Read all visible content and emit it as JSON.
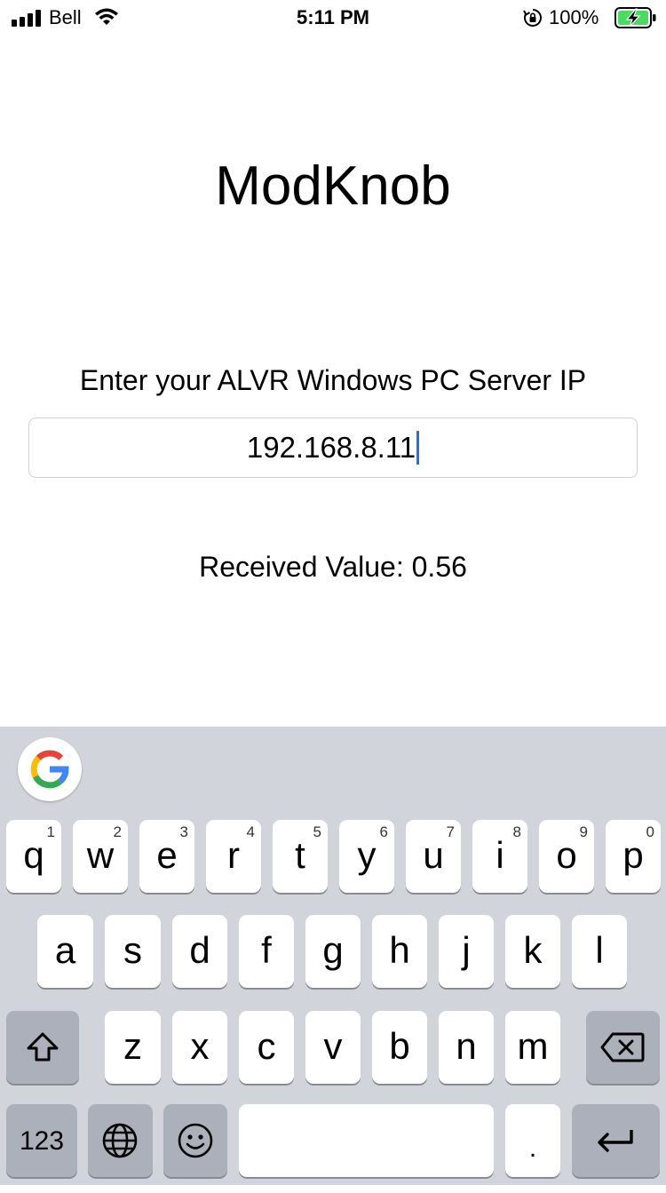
{
  "status_bar": {
    "carrier": "Bell",
    "time": "5:11 PM",
    "battery_percent": "100%",
    "icons": [
      "signal-icon",
      "wifi-icon",
      "rotation-lock-icon",
      "battery-charging-icon"
    ]
  },
  "app": {
    "title": "ModKnob",
    "ip_prompt": "Enter your ALVR Windows PC Server IP",
    "ip_value": "192.168.8.11",
    "received_value": "Received Value: 0.56"
  },
  "keyboard": {
    "google_button": "google-logo-icon",
    "row1": [
      {
        "label": "q",
        "hint": "1"
      },
      {
        "label": "w",
        "hint": "2"
      },
      {
        "label": "e",
        "hint": "3"
      },
      {
        "label": "r",
        "hint": "4"
      },
      {
        "label": "t",
        "hint": "5"
      },
      {
        "label": "y",
        "hint": "6"
      },
      {
        "label": "u",
        "hint": "7"
      },
      {
        "label": "i",
        "hint": "8"
      },
      {
        "label": "o",
        "hint": "9"
      },
      {
        "label": "p",
        "hint": "0"
      }
    ],
    "row2": [
      "a",
      "s",
      "d",
      "f",
      "g",
      "h",
      "j",
      "k",
      "l"
    ],
    "row3": [
      "z",
      "x",
      "c",
      "v",
      "b",
      "n",
      "m"
    ],
    "shift_icon": "shift-icon",
    "delete_icon": "delete-icon",
    "numbers_label": "123",
    "globe_icon": "globe-icon",
    "emoji_icon": "emoji-icon",
    "space_label": "",
    "period_label": ".",
    "return_icon": "return-icon"
  },
  "colors": {
    "keyboard_bg": "#d1d4da",
    "key_bg": "#ffffff",
    "dark_key_bg": "#abb0ba",
    "caret": "#1a73e8",
    "battery_fill": "#4cd964"
  }
}
